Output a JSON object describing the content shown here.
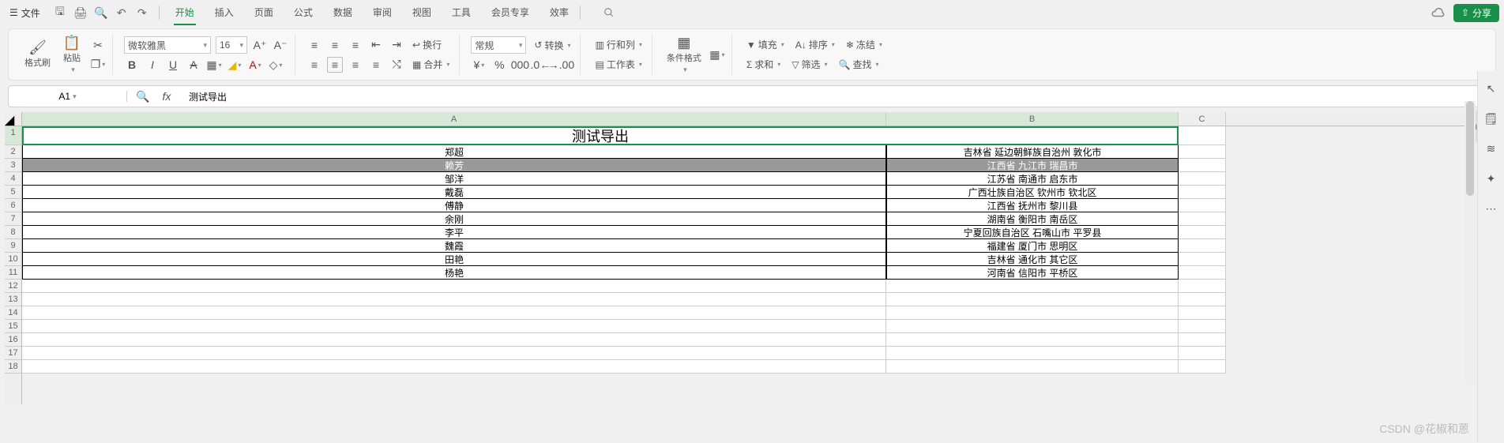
{
  "menubar": {
    "file": "文件",
    "tabs": [
      "开始",
      "插入",
      "页面",
      "公式",
      "数据",
      "审阅",
      "视图",
      "工具",
      "会员专享",
      "效率"
    ],
    "active_tab": 0,
    "share": "分享"
  },
  "ribbon": {
    "clipboard": {
      "format_painter": "格式刷",
      "paste": "粘贴"
    },
    "font": {
      "name": "微软雅黑",
      "size": "16"
    },
    "alignment": {
      "wrap": "换行",
      "merge": "合并"
    },
    "number": {
      "format": "常规",
      "convert": "转换"
    },
    "cells": {
      "row_col": "行和列",
      "worksheet": "工作表"
    },
    "styles": {
      "conditional": "条件格式"
    },
    "editing": {
      "fill": "填充",
      "sort": "排序",
      "freeze": "冻结",
      "sum": "求和",
      "filter": "筛选",
      "find": "查找"
    }
  },
  "formula_bar": {
    "name_box": "A1",
    "formula": "测试导出"
  },
  "columns": [
    "A",
    "B",
    "C"
  ],
  "row_headers": [
    "1",
    "2",
    "3",
    "4",
    "5",
    "6",
    "7",
    "8",
    "9",
    "10",
    "11",
    "12",
    "13",
    "14",
    "15",
    "16",
    "17",
    "18"
  ],
  "selected_row_index": 2,
  "title_cell": "测试导出",
  "rows": [
    {
      "a": "郑超",
      "b": "吉林省 延边朝鲜族自治州 敦化市"
    },
    {
      "a": "赖芳",
      "b": "江西省 九江市 瑞昌市"
    },
    {
      "a": "邹洋",
      "b": "江苏省 南通市 启东市"
    },
    {
      "a": "戴磊",
      "b": "广西壮族自治区 钦州市 钦北区"
    },
    {
      "a": "傅静",
      "b": "江西省 抚州市 黎川县"
    },
    {
      "a": "余刚",
      "b": "湖南省 衡阳市 南岳区"
    },
    {
      "a": "李平",
      "b": "宁夏回族自治区 石嘴山市 平罗县"
    },
    {
      "a": "魏霞",
      "b": "福建省 厦门市 思明区"
    },
    {
      "a": "田艳",
      "b": "吉林省 通化市 其它区"
    },
    {
      "a": "杨艳",
      "b": "河南省 信阳市 平桥区"
    }
  ],
  "watermark": "CSDN @花椒和蒽",
  "chart_data": {
    "type": "table",
    "title": "测试导出",
    "columns": [
      "A",
      "B"
    ],
    "rows": [
      [
        "郑超",
        "吉林省 延边朝鲜族自治州 敦化市"
      ],
      [
        "赖芳",
        "江西省 九江市 瑞昌市"
      ],
      [
        "邹洋",
        "江苏省 南通市 启东市"
      ],
      [
        "戴磊",
        "广西壮族自治区 钦州市 钦北区"
      ],
      [
        "傅静",
        "江西省 抚州市 黎川县"
      ],
      [
        "余刚",
        "湖南省 衡阳市 南岳区"
      ],
      [
        "李平",
        "宁夏回族自治区 石嘴山市 平罗县"
      ],
      [
        "魏霞",
        "福建省 厦门市 思明区"
      ],
      [
        "田艳",
        "吉林省 通化市 其它区"
      ],
      [
        "杨艳",
        "河南省 信阳市 平桥区"
      ]
    ]
  }
}
